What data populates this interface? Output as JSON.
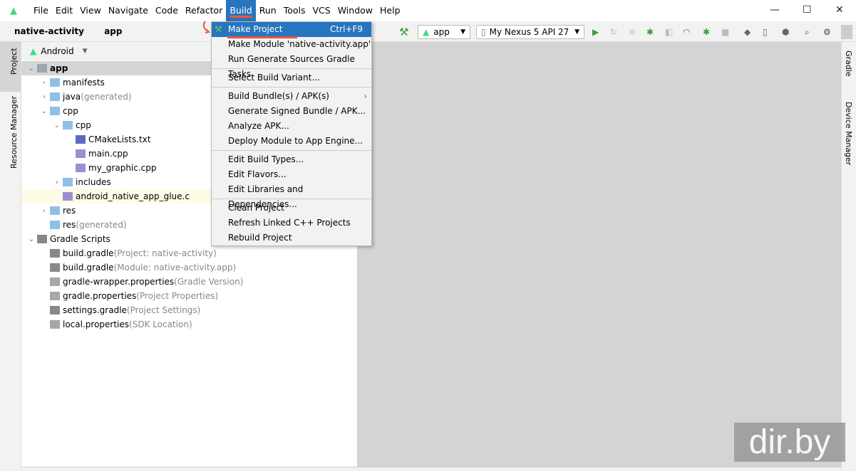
{
  "menu": [
    "File",
    "Edit",
    "View",
    "Navigate",
    "Code",
    "Refactor",
    "Build",
    "Run",
    "Tools",
    "VCS",
    "Window",
    "Help"
  ],
  "window_controls": [
    "—",
    "☐",
    "✕"
  ],
  "breadcrumb": {
    "project": "native-activity",
    "module": "app"
  },
  "toolbar": {
    "config": "app",
    "device": "My Nexus 5 API 27"
  },
  "left_strip": {
    "project": "Project",
    "resource_manager": "Resource Manager"
  },
  "right_strip": {
    "gradle": "Gradle",
    "device_manager": "Device Manager"
  },
  "panel": {
    "view": "Android"
  },
  "tree": [
    {
      "label": "app",
      "note": ""
    },
    {
      "label": "manifests",
      "note": ""
    },
    {
      "label": "java",
      "note": " (generated)"
    },
    {
      "label": "cpp",
      "note": ""
    },
    {
      "label": "cpp",
      "note": ""
    },
    {
      "label": "CMakeLists.txt",
      "note": ""
    },
    {
      "label": "main.cpp",
      "note": ""
    },
    {
      "label": "my_graphic.cpp",
      "note": ""
    },
    {
      "label": "includes",
      "note": ""
    },
    {
      "label": "android_native_app_glue.c",
      "note": ""
    },
    {
      "label": "res",
      "note": ""
    },
    {
      "label": "res",
      "note": " (generated)"
    },
    {
      "label": "Gradle Scripts",
      "note": ""
    },
    {
      "label": "build.gradle",
      "note": " (Project: native-activity)"
    },
    {
      "label": "build.gradle",
      "note": " (Module: native-activity.app)"
    },
    {
      "label": "gradle-wrapper.properties",
      "note": " (Gradle Version)"
    },
    {
      "label": "gradle.properties",
      "note": " (Project Properties)"
    },
    {
      "label": "settings.gradle",
      "note": " (Project Settings)"
    },
    {
      "label": "local.properties",
      "note": " (SDK Location)"
    }
  ],
  "build_menu": {
    "make_project": "Make Project",
    "make_project_shortcut": "Ctrl+F9",
    "items": [
      "Make Module 'native-activity.app'",
      "Run Generate Sources Gradle Tasks",
      "Select Build Variant...",
      "Build Bundle(s) / APK(s)",
      "Generate Signed Bundle / APK...",
      "Analyze APK...",
      "Deploy Module to App Engine...",
      "Edit Build Types...",
      "Edit Flavors...",
      "Edit Libraries and Dependencies...",
      "Clean Project",
      "Refresh Linked C++ Projects",
      "Rebuild Project"
    ]
  },
  "watermark": "dir.by"
}
